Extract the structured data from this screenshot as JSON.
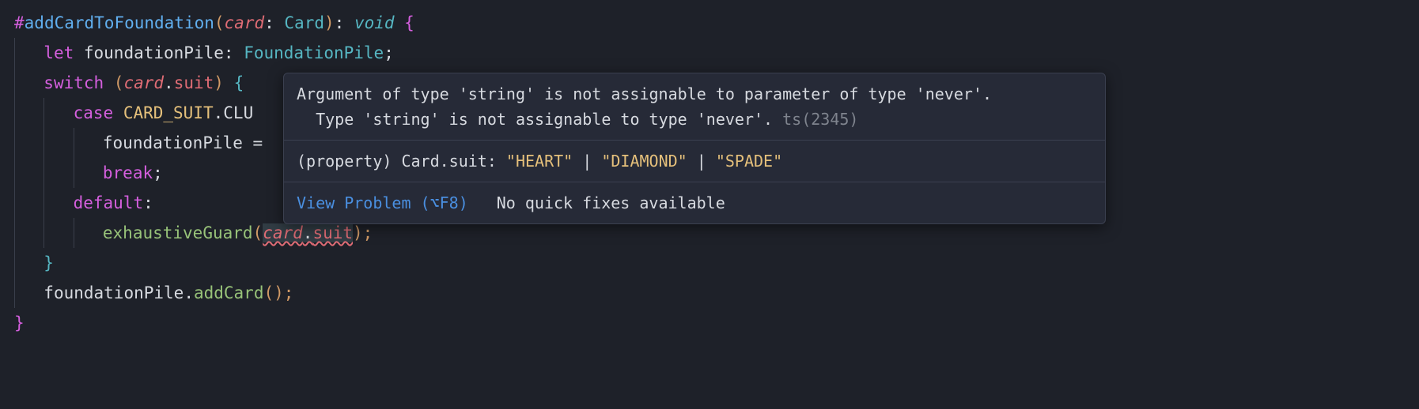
{
  "code": {
    "line1": {
      "hash": "#",
      "method": "addCardToFoundation",
      "open_paren": "(",
      "param": "card",
      "colon": ": ",
      "type": "Card",
      "close_paren": ")",
      "colon2": ": ",
      "void": "void",
      "space_brace": " {"
    },
    "line2": {
      "let": "let",
      "var": " foundationPile",
      "colon": ": ",
      "type": "FoundationPile",
      "semi": ";"
    },
    "line3": {
      "switch": "switch",
      "open": " (",
      "obj": "card",
      "dot": ".",
      "prop": "suit",
      "close": ") ",
      "brace": "{"
    },
    "line4": {
      "case": "case",
      "space": " ",
      "const": "CARD_SUIT",
      "dot": ".",
      "member": "CLU"
    },
    "line5": {
      "var": "foundationPile",
      "eq": " ="
    },
    "line6": {
      "break": "break",
      "semi": ";"
    },
    "line7": {
      "default": "default",
      "colon": ":"
    },
    "line8": {
      "fn": "exhaustiveGuard",
      "open": "(",
      "obj": "card",
      "dot": ".",
      "prop": "suit",
      "close": ");"
    },
    "line9": {
      "brace": "}"
    },
    "line10": {
      "var": "foundationPile",
      "dot": ".",
      "fn": "addCard",
      "parens": "();"
    },
    "line11": {
      "brace": "}"
    }
  },
  "hover": {
    "error_line1": "Argument of type 'string' is not assignable to parameter of type 'never'.",
    "error_line2": "  Type 'string' is not assignable to type 'never'. ",
    "error_code": "ts(2345)",
    "sig_prefix": "(property) Card.suit: ",
    "sig_val1": "\"HEART\"",
    "sig_sep": " | ",
    "sig_val2": "\"DIAMOND\"",
    "sig_val3": "\"SPADE\"",
    "view_problem": "View Problem (⌥F8)",
    "no_quick_fix": "No quick fixes available"
  }
}
